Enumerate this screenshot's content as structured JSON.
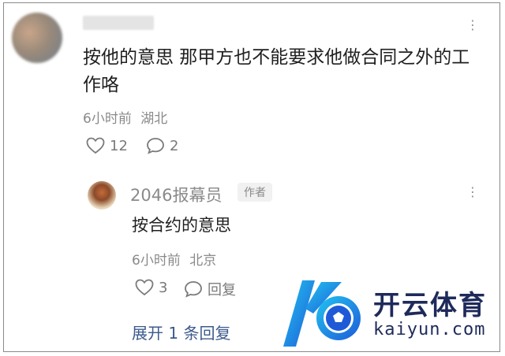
{
  "main_comment": {
    "text": "按他的意思 那甲方也不能要求他做合同之外的工作咯",
    "time": "6小时前",
    "location": "湖北",
    "likes": "12",
    "replies": "2"
  },
  "reply": {
    "username": "2046报幕员",
    "badge": "作者",
    "text": "按合约的意思",
    "time": "6小时前",
    "location": "北京",
    "likes": "3",
    "reply_label": "回复"
  },
  "expand_label": "展开 1 条回复",
  "watermark": {
    "title": "开云体育",
    "url": "kaiyun.com"
  },
  "icons": {
    "more": "more-dots-icon",
    "like": "heart-icon",
    "comment": "comment-bubble-icon",
    "logo": "kaiyun-logo-icon"
  },
  "colors": {
    "text_primary": "#1f1f1f",
    "text_secondary": "#8a8a8a",
    "link": "#3c5a8c",
    "watermark": "#1e2a5a"
  }
}
